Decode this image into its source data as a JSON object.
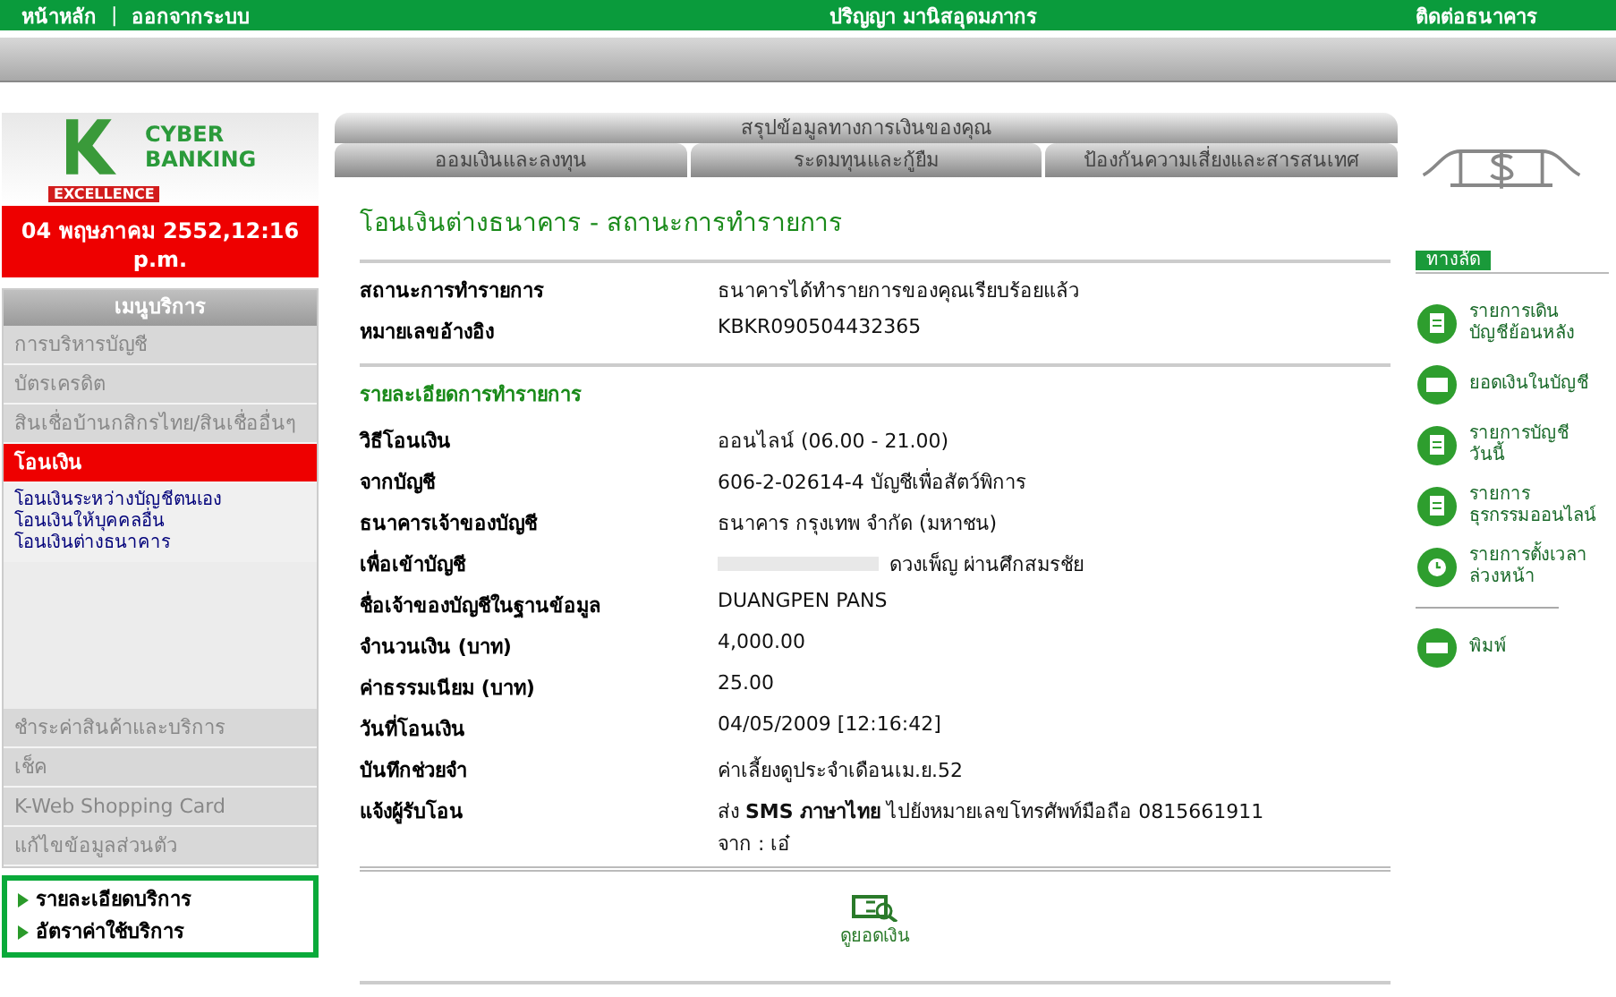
{
  "top_bar": {
    "links": [
      "หน้าหลัก",
      "ออกจากระบบ"
    ],
    "separator": "|",
    "user": "ปริญญา มานิสอุดมภากร",
    "contact": "ติดต่อธนาคาร"
  },
  "logo": {
    "line1": "CYBER",
    "line2": "BANKING",
    "tagline": "EXCELLENCE"
  },
  "date": "04 พฤษภาคม 2552,12:16 p.m.",
  "menu": {
    "title": "เมนูบริการ",
    "items": [
      {
        "label": "การบริหารบัญชี",
        "selected": false
      },
      {
        "label": "บัตรเครดิต",
        "selected": false
      },
      {
        "label": "สินเชื่อบ้านกสิกรไทย/สินเชื่ออื่นๆ",
        "selected": false
      },
      {
        "label": "โอนเงิน",
        "selected": true,
        "children": [
          {
            "label": "โอนเงินระหว่างบัญชีตนเอง"
          },
          {
            "label": "โอนเงินให้บุคคลอื่น"
          },
          {
            "label": "โอนเงินต่างธนาคาร"
          }
        ]
      }
    ],
    "lower_items": [
      "ชำระค่าสินค้าและบริการ",
      "เช็ค",
      "K-Web Shopping Card",
      "แก้ไขข้อมูลส่วนตัว"
    ]
  },
  "info_links": [
    "รายละเอียดบริการ",
    "อัตราค่าใช้บริการ"
  ],
  "tabs": {
    "header": "สรุปข้อมูลทางการเงินของคุณ",
    "items": [
      "ออมเงินและลงทุน",
      "ระดมทุนและกู้ยืม",
      "ป้องกันความเสี่ยงและสารสนเทศ"
    ]
  },
  "page_title": "โอนเงินต่างธนาคาร - สถานะการทำรายการ",
  "status_rows": [
    {
      "label": "สถานะการทำรายการ",
      "value": "ธนาคารได้ทำรายการของคุณเรียบร้อยแล้ว"
    },
    {
      "label": "หมายเลขอ้างอิง",
      "value": "KBKR090504432365"
    }
  ],
  "details_title": "รายละเอียดการทำรายการ",
  "detail_rows": [
    {
      "label": "วิธีโอนเงิน",
      "value": [
        "ออนไลน์ (06.00 - 21.00)"
      ],
      "redacted": false
    },
    {
      "label": "จากบัญชี",
      "value": [
        "606-2-02614-4 บัญชีเพื่อสัตว์พิการ"
      ],
      "redacted": false
    },
    {
      "label": "ธนาคารเจ้าของบัญชี",
      "value": [
        "ธนาคาร กรุงเทพ จำกัด (มหาชน)"
      ],
      "redacted": false
    },
    {
      "label": "เพื่อเข้าบัญชี",
      "value": [
        "ดวงเพ็ญ ผ่านศึกสมรชัย"
      ],
      "redacted": true
    },
    {
      "label": "ชื่อเจ้าของบัญชีในฐานข้อมูล",
      "value": [
        "DUANGPEN PANS"
      ],
      "redacted": false
    },
    {
      "label": "จำนวนเงิน (บาท)",
      "value": [
        "4,000.00"
      ],
      "redacted": false
    },
    {
      "label": "ค่าธรรมเนียม (บาท)",
      "value": [
        "25.00"
      ],
      "redacted": false
    },
    {
      "label": "วันที่โอนเงิน",
      "value": [
        "04/05/2009 [12:16:42]"
      ],
      "redacted": false
    },
    {
      "label": "บันทึกช่วยจำ",
      "value": [
        "ค่าเลี้ยงดูประจำเดือนเม.ย.52"
      ],
      "redacted": false
    },
    {
      "label": "แจ้งผู้รับโอน",
      "value": [
        "ส่ง **SMS ภาษาไทย** ไปยังหมายเลขโทรศัพท์มือถือ 0815661911",
        "จาก : เอ๋"
      ],
      "redacted": false
    }
  ],
  "balance_button": "ดูยอดเงิน",
  "shortcuts": {
    "title": "ทางลัด",
    "items": [
      {
        "lines": [
          "รายการเดิน",
          "บัญชีย้อนหลัง"
        ],
        "kind": "statement"
      },
      {
        "lines": [
          "ยอดเงินในบัญชี"
        ],
        "kind": "balance"
      },
      {
        "lines": [
          "รายการบัญชี",
          "วันนี้"
        ],
        "kind": "today"
      },
      {
        "lines": [
          "รายการ",
          "ธุรกรรมออนไลน์"
        ],
        "kind": "online"
      },
      {
        "lines": [
          "รายการตั้งเวลา",
          "ล่วงหน้า"
        ],
        "kind": "schedule"
      }
    ],
    "print": "พิมพ์"
  }
}
